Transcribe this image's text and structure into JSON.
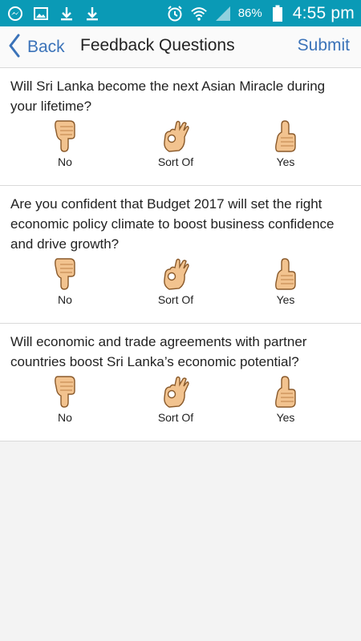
{
  "status_bar": {
    "battery_percent": "86%",
    "time": "4:55 pm",
    "icons": [
      "messenger-icon",
      "gallery-icon",
      "download-icon",
      "download-icon",
      "alarm-icon",
      "wifi-icon",
      "signal-icon",
      "battery-icon"
    ],
    "background_color": "#0a9ab6"
  },
  "navbar": {
    "back_label": "Back",
    "title": "Feedback Questions",
    "submit_label": "Submit",
    "accent_color": "#3b73b9"
  },
  "questions": [
    {
      "text": "Will Sri Lanka become the next Asian Miracle during your lifetime?",
      "options": [
        {
          "label": "No",
          "icon": "thumbs-down-icon"
        },
        {
          "label": "Sort Of",
          "icon": "ok-hand-icon"
        },
        {
          "label": "Yes",
          "icon": "thumbs-up-icon"
        }
      ]
    },
    {
      "text": "Are you confident that Budget 2017 will set the right economic policy climate to boost business confidence and drive growth?",
      "options": [
        {
          "label": "No",
          "icon": "thumbs-down-icon"
        },
        {
          "label": "Sort Of",
          "icon": "ok-hand-icon"
        },
        {
          "label": "Yes",
          "icon": "thumbs-up-icon"
        }
      ]
    },
    {
      "text": "Will economic and trade agreements with partner countries boost Sri Lanka’s economic potential?",
      "options": [
        {
          "label": "No",
          "icon": "thumbs-down-icon"
        },
        {
          "label": "Sort Of",
          "icon": "ok-hand-icon"
        },
        {
          "label": "Yes",
          "icon": "thumbs-up-icon"
        }
      ]
    }
  ]
}
